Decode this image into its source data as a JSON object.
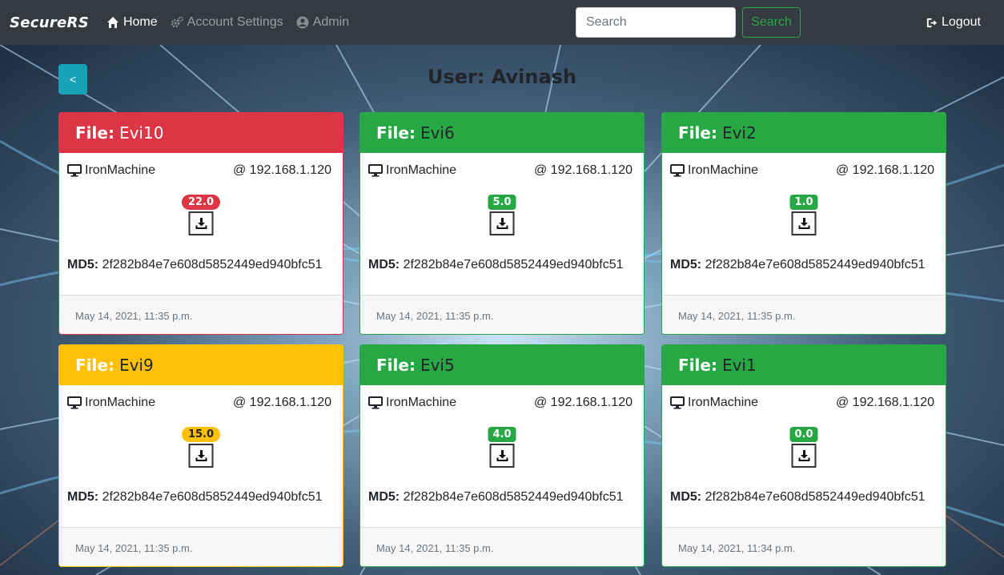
{
  "navbar": {
    "brand": "SecureRS",
    "links": [
      {
        "label": "Home",
        "icon": "home-icon",
        "active": true
      },
      {
        "label": "Account Settings",
        "icon": "cogs-icon",
        "active": false
      },
      {
        "label": "Admin",
        "icon": "user-circle-icon",
        "active": false
      }
    ],
    "search_placeholder": "Search",
    "search_button": "Search",
    "logout": "Logout"
  },
  "page": {
    "back_label": "<",
    "title": "User: Avinash"
  },
  "colors": {
    "danger": "#dc3545",
    "success": "#28a745",
    "warning": "#ffc107",
    "info": "#17a2b8",
    "navbar": "#343a40"
  },
  "cards": [
    {
      "file_label": "File:",
      "file_name": "Evi10",
      "status": "danger",
      "machine": "IronMachine",
      "ip": "@ 192.168.1.120",
      "score": "22.0",
      "md5_label": "MD5:",
      "md5": "2f282b84e7e608d5852449ed940bfc51",
      "date": "May 14, 2021, 11:35 p.m."
    },
    {
      "file_label": "File:",
      "file_name": "Evi6",
      "status": "success",
      "machine": "IronMachine",
      "ip": "@ 192.168.1.120",
      "score": "5.0",
      "md5_label": "MD5:",
      "md5": "2f282b84e7e608d5852449ed940bfc51",
      "date": "May 14, 2021, 11:35 p.m."
    },
    {
      "file_label": "File:",
      "file_name": "Evi2",
      "status": "success",
      "machine": "IronMachine",
      "ip": "@ 192.168.1.120",
      "score": "1.0",
      "md5_label": "MD5:",
      "md5": "2f282b84e7e608d5852449ed940bfc51",
      "date": "May 14, 2021, 11:35 p.m."
    },
    {
      "file_label": "File:",
      "file_name": "Evi9",
      "status": "warning",
      "machine": "IronMachine",
      "ip": "@ 192.168.1.120",
      "score": "15.0",
      "md5_label": "MD5:",
      "md5": "2f282b84e7e608d5852449ed940bfc51",
      "date": "May 14, 2021, 11:35 p.m."
    },
    {
      "file_label": "File:",
      "file_name": "Evi5",
      "status": "success",
      "machine": "IronMachine",
      "ip": "@ 192.168.1.120",
      "score": "4.0",
      "md5_label": "MD5:",
      "md5": "2f282b84e7e608d5852449ed940bfc51",
      "date": "May 14, 2021, 11:35 p.m."
    },
    {
      "file_label": "File:",
      "file_name": "Evi1",
      "status": "success",
      "machine": "IronMachine",
      "ip": "@ 192.168.1.120",
      "score": "0.0",
      "md5_label": "MD5:",
      "md5": "2f282b84e7e608d5852449ed940bfc51",
      "date": "May 14, 2021, 11:34 p.m."
    }
  ]
}
